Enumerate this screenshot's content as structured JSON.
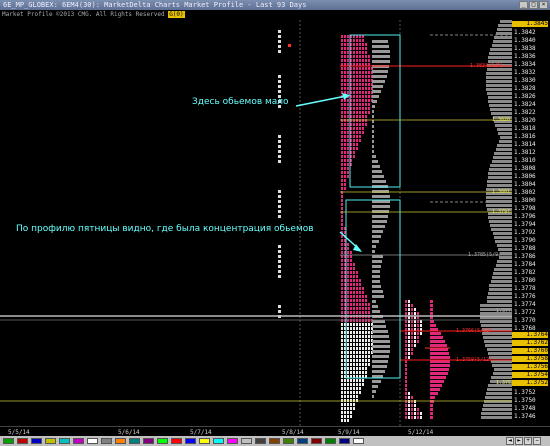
{
  "window": {
    "title": "6E_MP_GLOBEX: 6EM4(30): MarketDelta Charts Market Profile - Last 93 Days",
    "subtitle": "Market Profile ©2013 CMG. All Rights Reserved",
    "subtitle_tag": "G(0)"
  },
  "annotations": {
    "low_volume": "Здесь обьемов мало",
    "friday_profile": "По профилю пятницы видно, где была концентрация обьемов"
  },
  "price_axis": {
    "ticks": [
      "1.3844",
      "1.3842",
      "1.3840",
      "1.3838",
      "1.3836",
      "1.3834",
      "1.3832",
      "1.3830",
      "1.3828",
      "1.3826",
      "1.3824",
      "1.3822",
      "1.3820",
      "1.3818",
      "1.3816",
      "1.3814",
      "1.3812",
      "1.3810",
      "1.3808",
      "1.3806",
      "1.3804",
      "1.3802",
      "1.3800",
      "1.3798",
      "1.3796",
      "1.3794",
      "1.3792",
      "1.3790",
      "1.3788",
      "1.3786",
      "1.3784",
      "1.3782",
      "1.3780",
      "1.3778",
      "1.3776",
      "1.3774",
      "1.3772",
      "1.3770",
      "1.3768",
      "1.3766",
      "1.3764",
      "1.3762",
      "1.3760",
      "1.3758",
      "1.3756",
      "1.3754",
      "1.3752",
      "1.3750",
      "1.3748",
      "1.3746"
    ],
    "highlights": [
      {
        "label": "1.3845",
        "color": "#e8c000"
      },
      {
        "label": "1.3764",
        "color": "#e8c000"
      },
      {
        "label": "1.3762",
        "color": "#e8c000"
      },
      {
        "label": "1.3760",
        "color": "#e8c000"
      },
      {
        "label": "1.3758",
        "color": "#e8c000"
      },
      {
        "label": "1.3756",
        "color": "#e8c000"
      },
      {
        "label": "1.3754",
        "color": "#e8c000"
      },
      {
        "label": "1.3752",
        "color": "#e8c000"
      }
    ]
  },
  "price_levels": [
    {
      "text": "1.3834(5/9)",
      "color": "#ff3030"
    },
    {
      "text": "1.3820",
      "color": "#e8e850"
    },
    {
      "text": "1.3801",
      "color": "#e8e850"
    },
    {
      "text": "1.3797",
      "color": "#e8e850"
    },
    {
      "text": "1.3785(5/9)",
      "color": "#aaa"
    },
    {
      "text": "1.3772",
      "color": "#aaa"
    },
    {
      "text": "1.3766(5/12)",
      "color": "#ff3030"
    },
    {
      "text": "1.3759(5/12)",
      "color": "#ff3030"
    },
    {
      "text": "1.3752",
      "color": "#e8e850"
    }
  ],
  "dates": [
    "5/5/14",
    "5/6/14",
    "5/7/14",
    "5/8/14",
    "5/9/14",
    "5/12/14"
  ],
  "status_colors": [
    "#00a000",
    "#c00000",
    "#0000c0",
    "#c0c000",
    "#00c0c0",
    "#c000c0",
    "#ffffff",
    "#808080",
    "#ff8000",
    "#008080",
    "#800080",
    "#00ff00",
    "#ff0000",
    "#0000ff",
    "#ffff00",
    "#00ffff",
    "#ff00ff",
    "#c0c0c0",
    "#404040",
    "#804000",
    "#408000",
    "#004080",
    "#800000",
    "#008000",
    "#000080",
    "#ffffff"
  ],
  "window_buttons": {
    "minimize": "_",
    "maximize": "□",
    "close": "×"
  },
  "nav_buttons": {
    "back": "◄",
    "forward": "►",
    "zoom_in": "+",
    "zoom_out": "−"
  }
}
